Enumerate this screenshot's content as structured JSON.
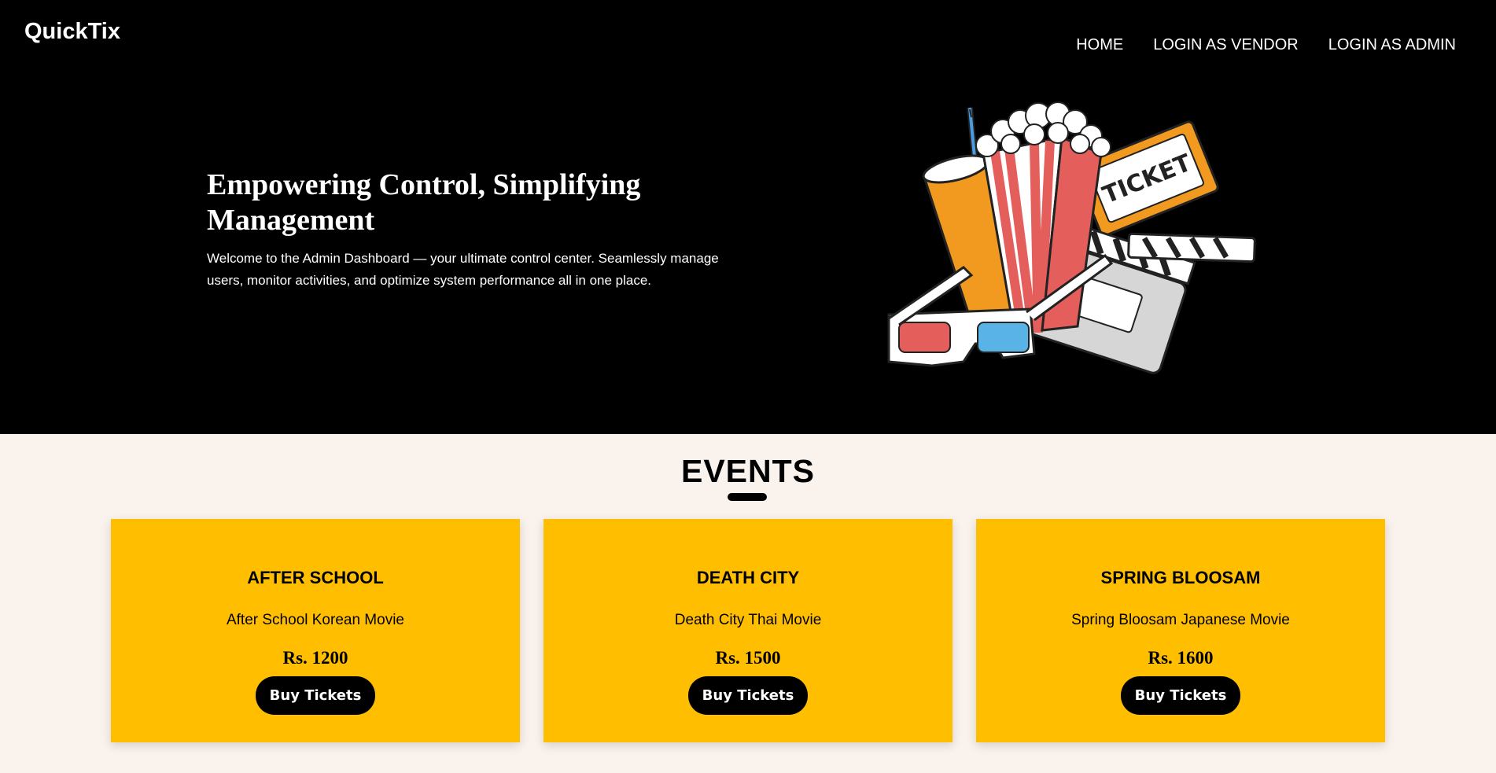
{
  "header": {
    "logo": "QuickTix",
    "nav": [
      "HOME",
      "LOGIN AS VENDOR",
      "LOGIN AS ADMIN"
    ]
  },
  "hero": {
    "title": "Empowering Control, Simplifying Management",
    "description": "Welcome to the Admin Dashboard — your ultimate control center. Seamlessly manage users, monitor activities, and optimize system performance all in one place.",
    "ticket_text": "TICKET"
  },
  "events": {
    "heading": "EVENTS",
    "cards": [
      {
        "title": "AFTER SCHOOL",
        "description": "After School Korean Movie",
        "price": "Rs. 1200",
        "button": "Buy Tickets"
      },
      {
        "title": "DEATH CITY",
        "description": "Death City Thai Movie",
        "price": "Rs. 1500",
        "button": "Buy Tickets"
      },
      {
        "title": "SPRING BLOOSAM",
        "description": "Spring Bloosam Japanese Movie",
        "price": "Rs. 1600",
        "button": "Buy Tickets"
      }
    ]
  },
  "colors": {
    "hero_bg": "#000000",
    "page_bg": "#faf2ec",
    "card_bg": "#ffbf00",
    "button_bg": "#000000"
  }
}
